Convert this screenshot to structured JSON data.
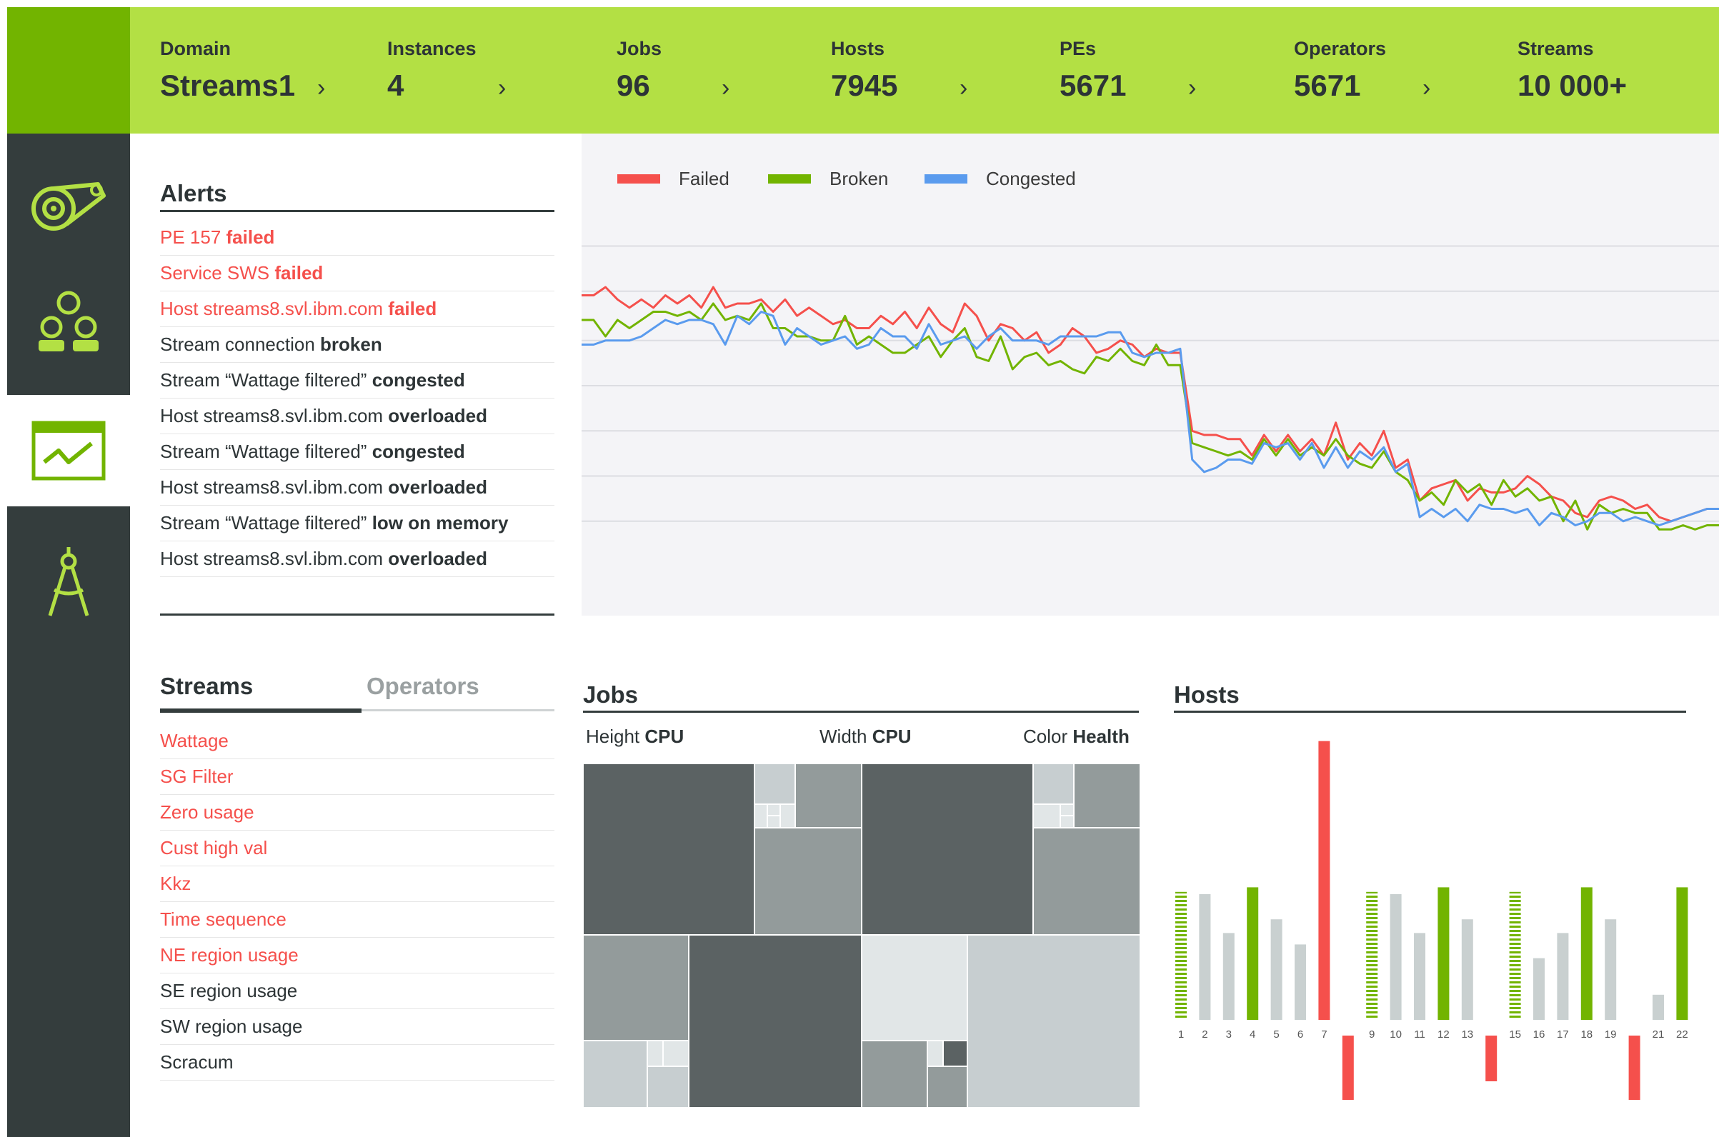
{
  "topbar": {
    "metrics": [
      {
        "label": "Domain",
        "value": "Streams1",
        "chevron": "›"
      },
      {
        "label": "Instances",
        "value": "4",
        "chevron": "›"
      },
      {
        "label": "Jobs",
        "value": "96",
        "chevron": "›"
      },
      {
        "label": "Hosts",
        "value": "7945",
        "chevron": "›"
      },
      {
        "label": "PEs",
        "value": "5671",
        "chevron": "›"
      },
      {
        "label": "Operators",
        "value": "5671",
        "chevron": "›"
      },
      {
        "label": "Streams",
        "value": "10 000+"
      }
    ]
  },
  "sidebar": {
    "items": [
      {
        "icon": "stream-reel-icon",
        "active": false
      },
      {
        "icon": "people-group-icon",
        "active": false
      },
      {
        "icon": "health-chart-icon",
        "active": true
      },
      {
        "icon": "compass-tool-icon",
        "active": false
      }
    ]
  },
  "alerts": {
    "title": "Alerts",
    "items": [
      {
        "text": "PE 157 ",
        "status": "failed",
        "color": "red"
      },
      {
        "text": "Service SWS ",
        "status": "failed",
        "color": "red"
      },
      {
        "text": "Host streams8.svl.ibm.com ",
        "status": "failed",
        "color": "red"
      },
      {
        "text": "Stream connection ",
        "status": "broken",
        "color": "dark"
      },
      {
        "text": "Stream “Wattage filtered” ",
        "status": "congested",
        "color": "dark"
      },
      {
        "text": "Host streams8.svl.ibm.com ",
        "status": "overloaded",
        "color": "dark"
      },
      {
        "text": "Stream “Wattage filtered” ",
        "status": "congested",
        "color": "dark"
      },
      {
        "text": "Host streams8.svl.ibm.com ",
        "status": "overloaded",
        "color": "dark"
      },
      {
        "text": "Stream “Wattage filtered” ",
        "status": "low on memory",
        "color": "dark"
      },
      {
        "text": "Host streams8.svl.ibm.com ",
        "status": "overloaded",
        "color": "dark"
      }
    ]
  },
  "trend": {
    "legend": [
      {
        "name": "Failed",
        "color": "#f5504c"
      },
      {
        "name": "Broken",
        "color": "#72b400"
      },
      {
        "name": "Congested",
        "color": "#5a9bee"
      }
    ]
  },
  "chart_data": [
    {
      "type": "line",
      "title": "",
      "grid": true,
      "legend_position": "top-left",
      "y_axis_labels": false,
      "ylim": [
        0,
        100
      ],
      "series": [
        {
          "name": "Failed",
          "color": "#f5504c",
          "values": [
            78,
            78,
            80,
            77,
            75,
            77,
            75,
            78,
            76,
            78,
            75,
            80,
            75,
            76,
            76,
            77,
            74,
            77,
            73,
            75,
            73,
            71,
            72,
            70,
            70,
            73,
            71,
            74,
            70,
            75,
            71,
            69,
            76,
            73,
            67,
            71,
            70,
            67,
            69,
            64,
            66,
            70,
            68,
            64,
            65,
            67,
            66,
            63,
            65,
            64,
            64,
            45,
            44,
            44,
            43,
            43,
            39,
            44,
            40,
            44,
            40,
            43,
            39,
            47,
            38,
            42,
            39,
            45,
            36,
            38,
            28,
            31,
            32,
            33,
            28,
            31,
            30,
            30,
            31,
            34,
            32,
            29,
            28,
            25,
            24,
            28,
            29,
            28,
            26,
            27,
            24,
            23,
            24,
            25,
            26,
            26
          ]
        },
        {
          "name": "Broken",
          "color": "#72b400",
          "values": [
            72,
            72,
            68,
            72,
            70,
            72,
            74,
            74,
            73,
            74,
            72,
            76,
            72,
            73,
            72,
            76,
            70,
            70,
            68,
            68,
            67,
            67,
            73,
            66,
            68,
            66,
            64,
            64,
            66,
            68,
            63,
            67,
            70,
            63,
            62,
            68,
            60,
            63,
            64,
            61,
            62,
            60,
            59,
            63,
            62,
            65,
            62,
            61,
            66,
            61,
            61,
            42,
            41,
            40,
            39,
            40,
            38,
            43,
            39,
            43,
            39,
            41,
            39,
            43,
            39,
            37,
            36,
            40,
            35,
            33,
            28,
            30,
            27,
            33,
            30,
            32,
            27,
            33,
            29,
            31,
            28,
            29,
            23,
            28,
            21,
            27,
            25,
            26,
            25,
            25,
            21,
            21,
            22,
            21,
            22,
            22
          ]
        },
        {
          "name": "Congested",
          "color": "#5a9bee",
          "values": [
            66,
            66,
            67,
            67,
            67,
            68,
            70,
            72,
            71,
            72,
            72,
            71,
            66,
            73,
            71,
            74,
            73,
            66,
            70,
            68,
            66,
            67,
            68,
            65,
            66,
            70,
            68,
            68,
            65,
            71,
            66,
            67,
            68,
            65,
            68,
            70,
            67,
            67,
            67,
            66,
            68,
            68,
            68,
            68,
            69,
            69,
            64,
            63,
            64,
            64,
            65,
            38,
            35,
            36,
            38,
            38,
            37,
            42,
            41,
            42,
            38,
            42,
            36,
            41,
            36,
            40,
            38,
            41,
            35,
            37,
            24,
            26,
            24,
            26,
            23,
            27,
            26,
            26,
            25,
            26,
            22,
            25,
            24,
            22,
            23,
            25,
            25,
            23,
            24,
            23,
            22,
            23,
            24,
            25,
            26,
            26
          ]
        }
      ]
    },
    {
      "type": "heatmap",
      "title": "Jobs",
      "encoding": {
        "height": "CPU",
        "width": "CPU",
        "color": "Health"
      },
      "color_scale": [
        "#5b6263",
        "#939b9b",
        "#c7ced0",
        "#e1e6e7"
      ]
    },
    {
      "type": "bar",
      "title": "Hosts",
      "categories": [
        "1",
        "2",
        "3",
        "4",
        "5",
        "6",
        "7",
        "",
        "9",
        "10",
        "11",
        "12",
        "13",
        "",
        "15",
        "16",
        "17",
        "18",
        "19",
        "",
        "21",
        "22"
      ],
      "values": [
        56,
        55,
        38,
        58,
        44,
        33,
        122,
        -34,
        56,
        55,
        38,
        58,
        44,
        -20,
        56,
        27,
        38,
        58,
        44,
        -31,
        11,
        58
      ],
      "colors": [
        "hatched-green",
        "grey",
        "grey",
        "green",
        "grey",
        "grey",
        "red",
        "red",
        "hatched-green",
        "grey",
        "grey",
        "green",
        "grey",
        "red",
        "hatched-green",
        "grey",
        "grey",
        "green",
        "grey",
        "red",
        "grey",
        "green"
      ]
    }
  ],
  "streams_panel": {
    "tabs": [
      {
        "label": "Streams",
        "active": true
      },
      {
        "label": "Operators",
        "active": false
      }
    ],
    "items": [
      {
        "name": "Wattage",
        "color": "red"
      },
      {
        "name": "SG Filter",
        "color": "red"
      },
      {
        "name": "Zero usage",
        "color": "red"
      },
      {
        "name": "Cust high val",
        "color": "red"
      },
      {
        "name": "Kkz",
        "color": "red"
      },
      {
        "name": "Time sequence",
        "color": "red"
      },
      {
        "name": "NE region usage",
        "color": "red"
      },
      {
        "name": "SE region usage",
        "color": "dark"
      },
      {
        "name": "SW region usage",
        "color": "dark"
      },
      {
        "name": "Scracum",
        "color": "dark"
      }
    ]
  },
  "jobs": {
    "title": "Jobs",
    "keys": [
      {
        "prefix": "Height ",
        "metric": "CPU"
      },
      {
        "prefix": "Width ",
        "metric": "CPU"
      },
      {
        "prefix": "Color ",
        "metric": "Health"
      }
    ]
  },
  "hosts": {
    "title": "Hosts"
  }
}
